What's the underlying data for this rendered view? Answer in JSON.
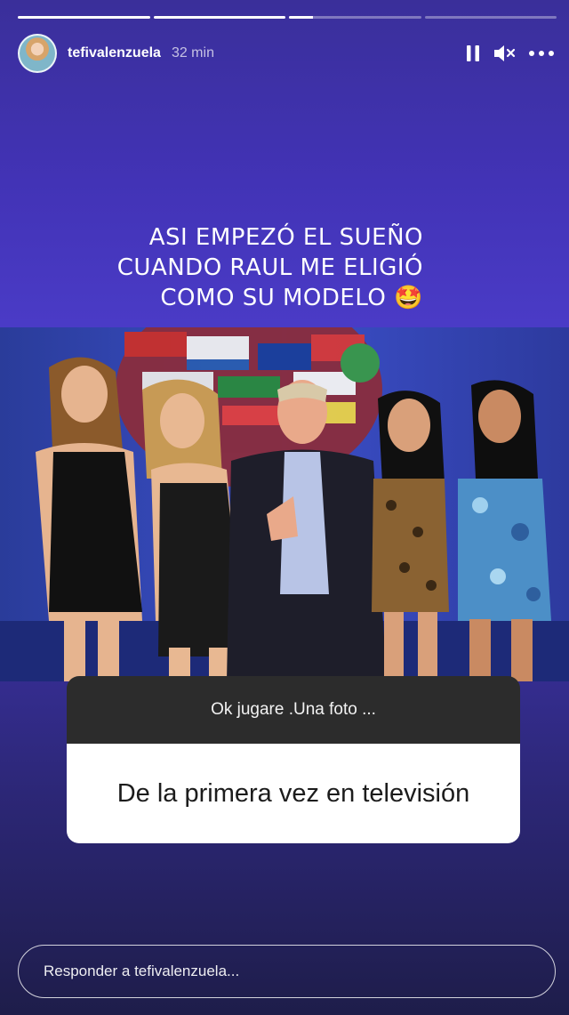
{
  "story": {
    "progress": [
      1.0,
      1.0,
      0.18,
      0.0
    ],
    "username": "tefivalenzuela",
    "time": "32 min"
  },
  "controls": {
    "icons": [
      "pause-icon",
      "volume-muted-icon",
      "more-options-icon"
    ]
  },
  "caption": {
    "lines": [
      "ASI EMPEZÓ EL SUEÑO",
      "CUANDO RAUL ME ELIGIÓ",
      "COMO SU MODELO 🤩"
    ]
  },
  "question_sticker": {
    "question": "Ok jugare .Una foto ...",
    "answer": "De la primera vez en televisión"
  },
  "reply": {
    "placeholder": "Responder a tefivalenzuela..."
  },
  "colors": {
    "accent": "#4a3bc6",
    "sticker_dark": "#2c2c2c",
    "sticker_light": "#ffffff"
  }
}
